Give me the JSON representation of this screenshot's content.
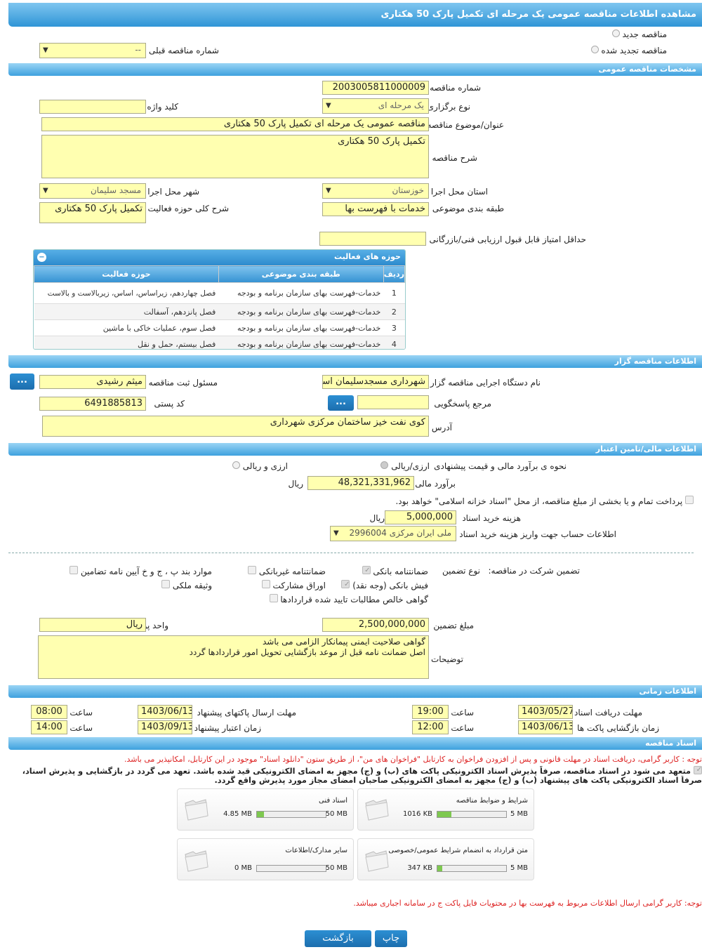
{
  "title": "مشاهده اطلاعات مناقصه عمومی یک مرحله ای تکمیل پارک 50 هکتاری",
  "top": {
    "new_tender": "مناقصه جدید",
    "renewed_tender": "مناقصه تجدید شده",
    "prev_number_label": "شماره مناقصه قبلی",
    "prev_number_value": "--"
  },
  "general": {
    "header": "مشخصات مناقصه عمومی",
    "number_label": "شماره مناقصه",
    "number_value": "2003005811000009",
    "type_label": "نوع برگزاری",
    "type_value": "یک مرحله ای",
    "keyword_label": "کلید واژه",
    "keyword_value": "",
    "subject_label": "عنوان/موضوع مناقصه",
    "subject_value": "مناقصه عمومی یک مرحله ای تکمیل پارک 50 هکتاری",
    "desc_label": "شرح مناقصه",
    "desc_value": "تکمیل پارک 50 هکتاری",
    "province_label": "استان محل اجرا",
    "province_value": "خوزستان",
    "city_label": "شهر محل اجرا",
    "city_value": "مسجد سلیمان",
    "category_label": "طبقه بندی موضوعی",
    "category_value": "خدمات با فهرست بها",
    "scope_label": "شرح کلی حوزه فعالیت",
    "scope_value": "تکمیل پارک 50 هکتاری",
    "minscore_label": "حداقل امتیاز قابل قبول ارزیابی فنی/بازرگانی",
    "minscore_value": ""
  },
  "activities": {
    "title": "حوزه های فعالیت",
    "cols": [
      "ردیف",
      "طبقه بندی موضوعی",
      "حوزه فعالیت"
    ],
    "rows": [
      {
        "n": "1",
        "cat": "خدمات-فهرست بهای سازمان برنامه و بودجه",
        "act": "فصل چهاردهم، زیراساس، اساس، زیربالاست و بالاست"
      },
      {
        "n": "2",
        "cat": "خدمات-فهرست بهای سازمان برنامه و بودجه",
        "act": "فصل پانزدهم، آسفالت"
      },
      {
        "n": "3",
        "cat": "خدمات-فهرست بهای سازمان برنامه و بودجه",
        "act": "فصل سوم، عملیات خاکی با ماشین"
      },
      {
        "n": "4",
        "cat": "خدمات-فهرست بهای سازمان برنامه و بودجه",
        "act": "فصل بیستم، حمل و نقل"
      }
    ]
  },
  "org": {
    "header": "اطلاعات مناقصه گزار",
    "name_label": "نام دستگاه اجرایی مناقصه گزار",
    "name_value": "شهرداری مسجدسلیمان استان",
    "resp_label": "مسئول ثبت مناقصه",
    "resp_value": "میثم رشیدی",
    "ref_label": "مرجع پاسخگویی",
    "ref_value": "",
    "postal_label": "کد پستی",
    "postal_value": "6491885813",
    "address_label": "آدرس",
    "address_value": "کوی نفت خیز ساختمان مرکزی شهرداری",
    "dots": "..."
  },
  "finance": {
    "header": "اطلاعات مالی/تامین اعتبار",
    "method_label": "نحوه ی برآورد مالی و قیمت پیشنهادی",
    "opt1": "ارزی/ریالی",
    "opt2": "ارزی و ریالی",
    "estimate_label": "برآورد مالی",
    "estimate_value": "48,321,331,962",
    "rial": "ریال",
    "treasury_text": "پرداخت تمام و یا بخشی از مبلغ مناقصه، از محل \"اسناد خزانه اسلامی\" خواهد بود.",
    "docfee_label": "هزینه خرید اسناد",
    "docfee_value": "5,000,000",
    "account_label": "اطلاعات حساب جهت واریز هزینه خرید اسناد",
    "account_value": "ملی ایران مرکزی 2996004"
  },
  "guarantee": {
    "label": "تضمین شرکت در مناقصه:",
    "type_label": "نوع تضمین",
    "g1": "ضمانتنامه بانکی",
    "g2": "ضمانتنامه غیربانکی",
    "g3": "موارد بند پ ، ج و خ آیین نامه تضامین",
    "g4": "فیش بانکی (وجه نقد)",
    "g5": "اوراق مشارکت",
    "g6": "وثیقه ملکی",
    "g7": "گواهی خالص مطالبات تایید شده قراردادها",
    "amount_label": "مبلغ تضمین",
    "amount_value": "2,500,000,000",
    "unit_label": "واحد پول",
    "unit_value": "ریال",
    "notes_label": "توضیحات",
    "notes_line1": "گواهی صلاحیت ایمنی پیمانکار الزامی می باشد",
    "notes_line2": "اصل ضمانت نامه قبل از موعد بازگشایی تحویل امور قراردادها گردد"
  },
  "timing": {
    "header": "اطلاعات زمانی",
    "receive_label": "مهلت دریافت اسناد",
    "receive_date": "1403/05/27",
    "receive_time": "19:00",
    "send_label": "مهلت ارسال پاکتهای پیشنهاد",
    "send_date": "1403/06/13",
    "send_time": "08:00",
    "open_label": "زمان بازگشایی پاکت ها",
    "open_date": "1403/06/13",
    "open_time": "12:00",
    "valid_label": "زمان اعتبار پیشنهاد",
    "valid_date": "1403/09/13",
    "valid_time": "14:00",
    "time_label": "ساعت"
  },
  "docs": {
    "header": "اسناد مناقصه",
    "note1": "توجه : کاربر گرامی، دریافت اسناد در مهلت قانونی و پس از افزودن فراخوان به کارتابل \"فراخوان های من\"، از طریق ستون \"دانلود اسناد\" موجود در این کارتابل، امکانپذیر می باشد.",
    "note2": "متعهد می شود در اسناد مناقصه، صرفاً پذیرش اسناد الکترونیکی پاکت های (ب) و (ج) مجهز به امضای الکترونیکی قید شده باشد. تعهد می گردد در بازگشایی و پذیرش اسناد،",
    "note3": "صرفاً اسناد الکترونیکی پاکت های پیشنهاد (ب) و (ج) مجهز به امضای الکترونیکی صاحبان امضای مجاز مورد پذیرش واقع گردد.",
    "files": [
      {
        "name": "شرایط و ضوابط مناقصه",
        "size": "1016 KB",
        "max": "5 MB",
        "fill": 0.2
      },
      {
        "name": "اسناد فنی",
        "size": "4.85 MB",
        "max": "50 MB",
        "fill": 0.1
      },
      {
        "name": "متن قرارداد به انضمام شرایط عمومی/خصوصی",
        "size": "347 KB",
        "max": "5 MB",
        "fill": 0.07
      },
      {
        "name": "سایر مدارک/اطلاعات",
        "size": "0 MB",
        "max": "50 MB",
        "fill": 0
      }
    ],
    "note4": "توجه: کاربر گرامی ارسال اطلاعات مربوط به فهرست بها در محتویات فایل پاکت ج در سامانه اجباری میباشد."
  },
  "buttons": {
    "print": "چاپ",
    "back": "بازگشت"
  }
}
